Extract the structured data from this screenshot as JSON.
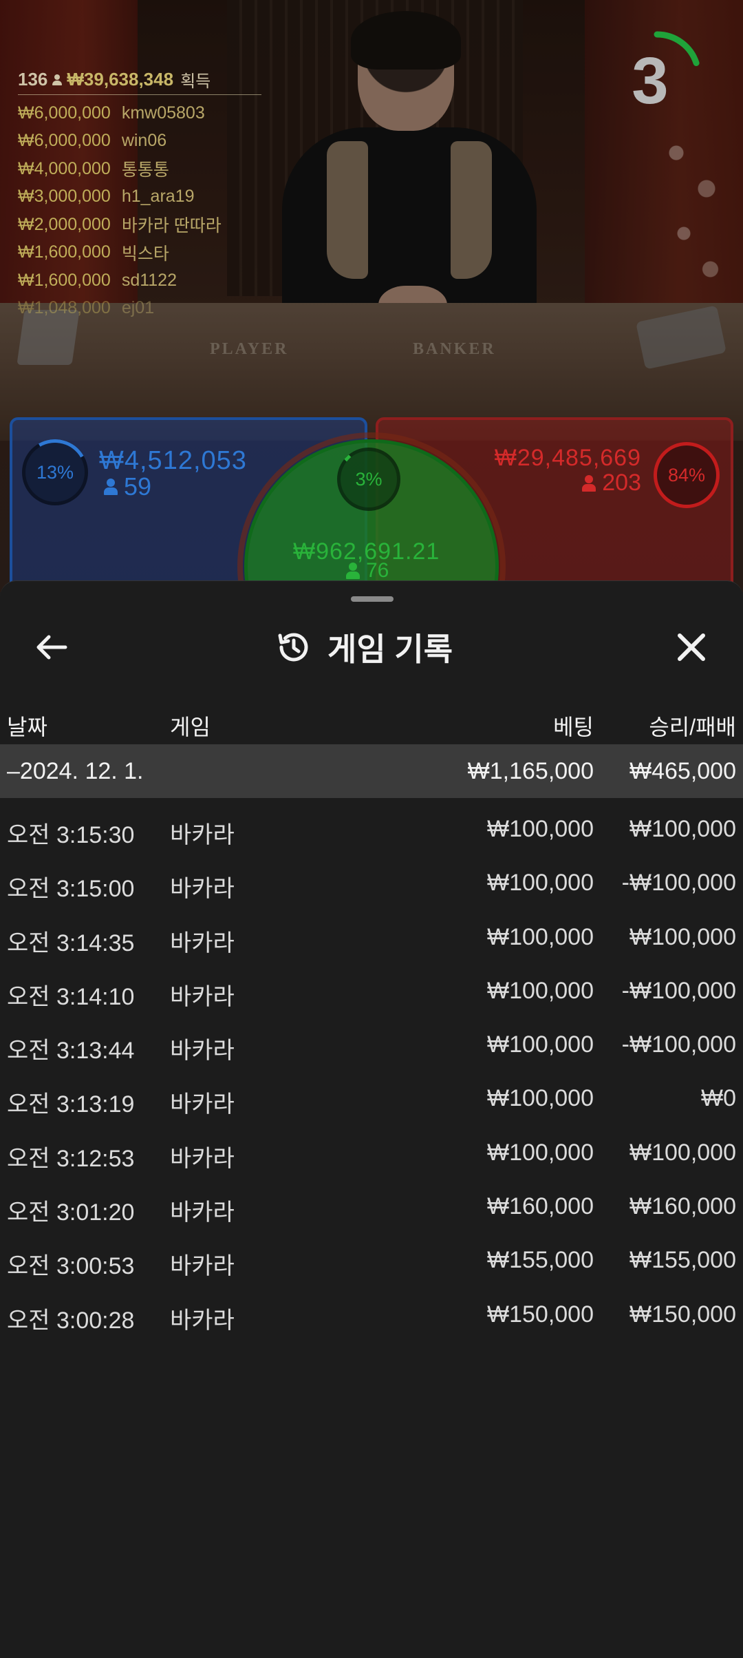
{
  "live_stream": {
    "table_labels": [
      "PLAYER",
      "BANKER"
    ],
    "countdown": "3",
    "countdown_fraction_remaining": 0.2
  },
  "bettors": {
    "total_count": "136",
    "total_amount": "₩39,638,348",
    "total_label": "획득",
    "list": [
      {
        "amount": "₩6,000,000",
        "name": "kmw05803"
      },
      {
        "amount": "₩6,000,000",
        "name": "win06"
      },
      {
        "amount": "₩4,000,000",
        "name": "통통통"
      },
      {
        "amount": "₩3,000,000",
        "name": "h1_ara19"
      },
      {
        "amount": "₩2,000,000",
        "name": "바카라 딴따라"
      },
      {
        "amount": "₩1,600,000",
        "name": "빅스타"
      },
      {
        "amount": "₩1,600,000",
        "name": "sd1122"
      },
      {
        "amount": "₩1,048,000",
        "name": "ej01"
      }
    ]
  },
  "betting_areas": {
    "player": {
      "percent": "13%",
      "amount": "₩4,512,053",
      "players": "59",
      "color": "#2e78d4"
    },
    "tie": {
      "percent": "3%",
      "amount": "₩962,691.21",
      "players": "76",
      "color": "#29b33a"
    },
    "banker": {
      "percent": "84%",
      "amount": "₩29,485,669",
      "players": "203",
      "color": "#d42a2a"
    }
  },
  "history": {
    "title": "게임 기록",
    "columns": {
      "date": "날짜",
      "game": "게임",
      "bet": "베팅",
      "result": "승리/패배"
    },
    "day_group": {
      "date": "–2024. 12. 1.",
      "bet": "₩1,165,000",
      "result": "₩465,000"
    },
    "rows": [
      {
        "time": "오전 3:15:30",
        "game": "바카라",
        "bet": "₩100,000",
        "result": "₩100,000"
      },
      {
        "time": "오전 3:15:00",
        "game": "바카라",
        "bet": "₩100,000",
        "result": "-₩100,000"
      },
      {
        "time": "오전 3:14:35",
        "game": "바카라",
        "bet": "₩100,000",
        "result": "₩100,000"
      },
      {
        "time": "오전 3:14:10",
        "game": "바카라",
        "bet": "₩100,000",
        "result": "-₩100,000"
      },
      {
        "time": "오전 3:13:44",
        "game": "바카라",
        "bet": "₩100,000",
        "result": "-₩100,000"
      },
      {
        "time": "오전 3:13:19",
        "game": "바카라",
        "bet": "₩100,000",
        "result": "₩0"
      },
      {
        "time": "오전 3:12:53",
        "game": "바카라",
        "bet": "₩100,000",
        "result": "₩100,000"
      },
      {
        "time": "오전 3:01:20",
        "game": "바카라",
        "bet": "₩160,000",
        "result": "₩160,000"
      },
      {
        "time": "오전 3:00:53",
        "game": "바카라",
        "bet": "₩155,000",
        "result": "₩155,000"
      },
      {
        "time": "오전 3:00:28",
        "game": "바카라",
        "bet": "₩150,000",
        "result": "₩150,000"
      }
    ]
  },
  "icons": {
    "back": "arrow-left-icon",
    "history": "history-clock-icon",
    "close": "close-x-icon",
    "person": "person-icon"
  }
}
